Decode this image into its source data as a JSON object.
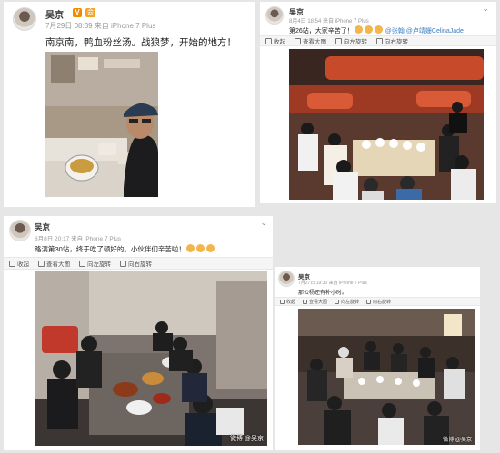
{
  "post1": {
    "user": "吴京",
    "vip": "V",
    "level": "会",
    "meta": "7月29日 08:39 来自 iPhone 7 Plus",
    "text": "南京南，鸭血粉丝汤。战狼梦，开始的地方！"
  },
  "post2": {
    "user": "吴京",
    "meta": "8月4日 18:54 来自 iPhone 7 Plus",
    "text_prefix": "第26站，大家辛苦了！",
    "mentions": "@张翰 @卢靖姗CelinaJade",
    "toolbar": [
      "收起",
      "查看大图",
      "向左旋转",
      "向右旋转"
    ]
  },
  "post3": {
    "user": "吴京",
    "meta": "8月8日 20:17 来自 iPhone 7 Plus",
    "text": "路演第30站，终于吃了顿好的。小伙伴们辛苦啦！",
    "toolbar": [
      "收起",
      "查看大图",
      "向左旋转",
      "向右旋转"
    ],
    "watermark": "微博 @吴京"
  },
  "post4": {
    "user": "吴京",
    "meta": "7月27日 19:30 来自 iPhone 7 Plus",
    "text": "那公杨还有补小时。",
    "toolbar": [
      "收起",
      "查看大图",
      "向左旋转",
      "向右旋转"
    ],
    "watermark": "微博 @吴京"
  },
  "icons": [
    "chevron-down-icon",
    "collapse-icon",
    "zoom-icon",
    "rotate-left-icon",
    "rotate-right-icon",
    "emoji-icon"
  ]
}
